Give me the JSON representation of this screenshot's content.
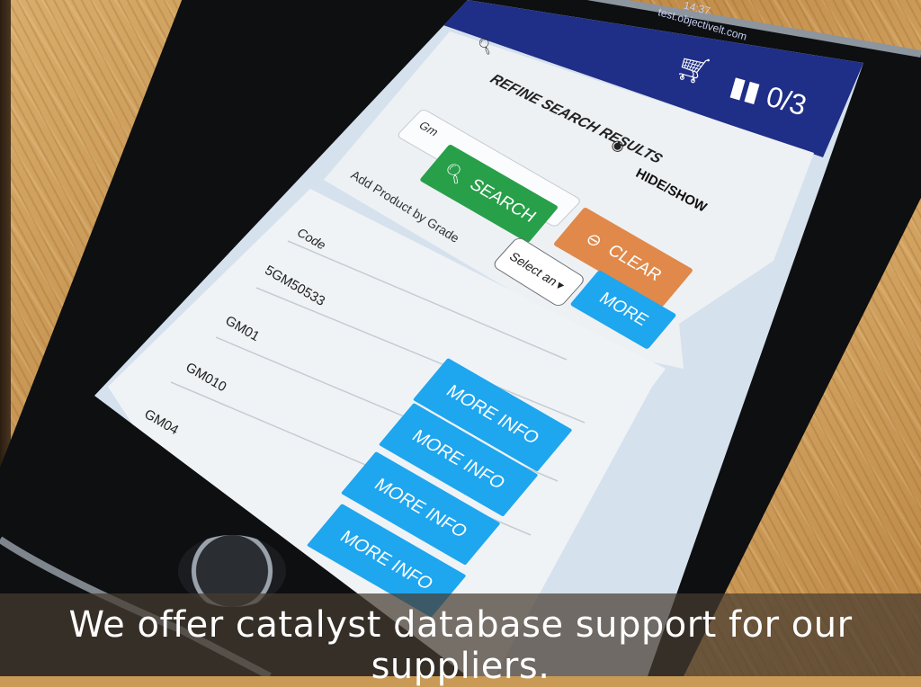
{
  "status": {
    "time": "14:37",
    "url": "test.objectivelt.com"
  },
  "header": {
    "counter": "0/3",
    "cart_icon": "cart-icon",
    "binoculars_icon": "binoculars-icon"
  },
  "filter": {
    "title": "REFINE SEARCH RESULTS",
    "search_value": "Gm",
    "hide_show_label": "HIDE/SHOW",
    "add_by_grade_label": "Add Product by Grade",
    "search_button": "SEARCH",
    "clear_button": "CLEAR",
    "select_placeholder": "Select an",
    "more_button": "MORE"
  },
  "results": {
    "column_header": "Code",
    "rows": [
      {
        "code": "5GM50533",
        "action": ""
      },
      {
        "code": "GM01",
        "action": "MORE INFO"
      },
      {
        "code": "GM010",
        "action": "MORE INFO"
      },
      {
        "code": "GM04",
        "action": "MORE INFO"
      },
      {
        "code": "",
        "action": "MORE INFO"
      }
    ]
  },
  "caption": "We offer catalyst database support for our suppliers."
}
